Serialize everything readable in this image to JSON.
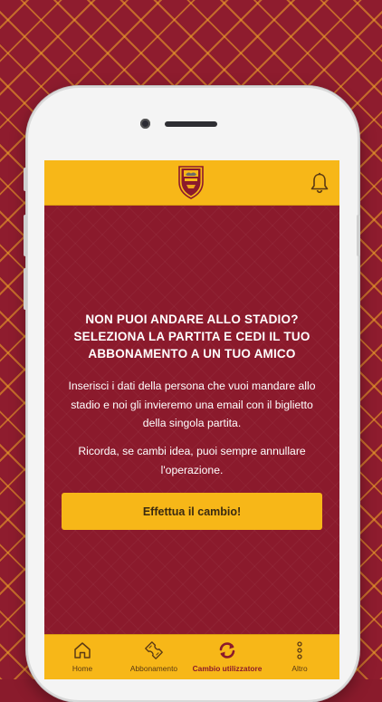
{
  "colors": {
    "brand_red": "#8b1a2c",
    "brand_yellow": "#f7b718",
    "text_on_red": "#ffffff"
  },
  "header": {
    "logo_icon": "as-roma-crest-icon",
    "notification_icon": "bell-icon"
  },
  "main": {
    "heading_lines": [
      "NON PUOI ANDARE ALLO STADIO?",
      "SELEZIONA LA PARTITA E CEDI IL TUO",
      "ABBONAMENTO A UN TUO AMICO"
    ],
    "paragraph1_lines": [
      "Inserisci i dati della persona che vuoi mandare allo",
      "stadio e noi gli invieremo una email con il biglietto",
      "della singola partita."
    ],
    "paragraph2_lines": [
      "Ricorda, se cambi idea, puoi sempre annullare",
      "l'operazione."
    ],
    "cta_label": "Effettua il cambio!"
  },
  "tabbar": {
    "tabs": [
      {
        "label": "Home",
        "icon": "home-icon",
        "active": false
      },
      {
        "label": "Abbonamento",
        "icon": "ticket-icon",
        "active": false
      },
      {
        "label": "Cambio utilizzatore",
        "icon": "swap-arrows-icon",
        "active": true
      },
      {
        "label": "Altro",
        "icon": "more-vertical-icon",
        "active": false
      }
    ]
  }
}
